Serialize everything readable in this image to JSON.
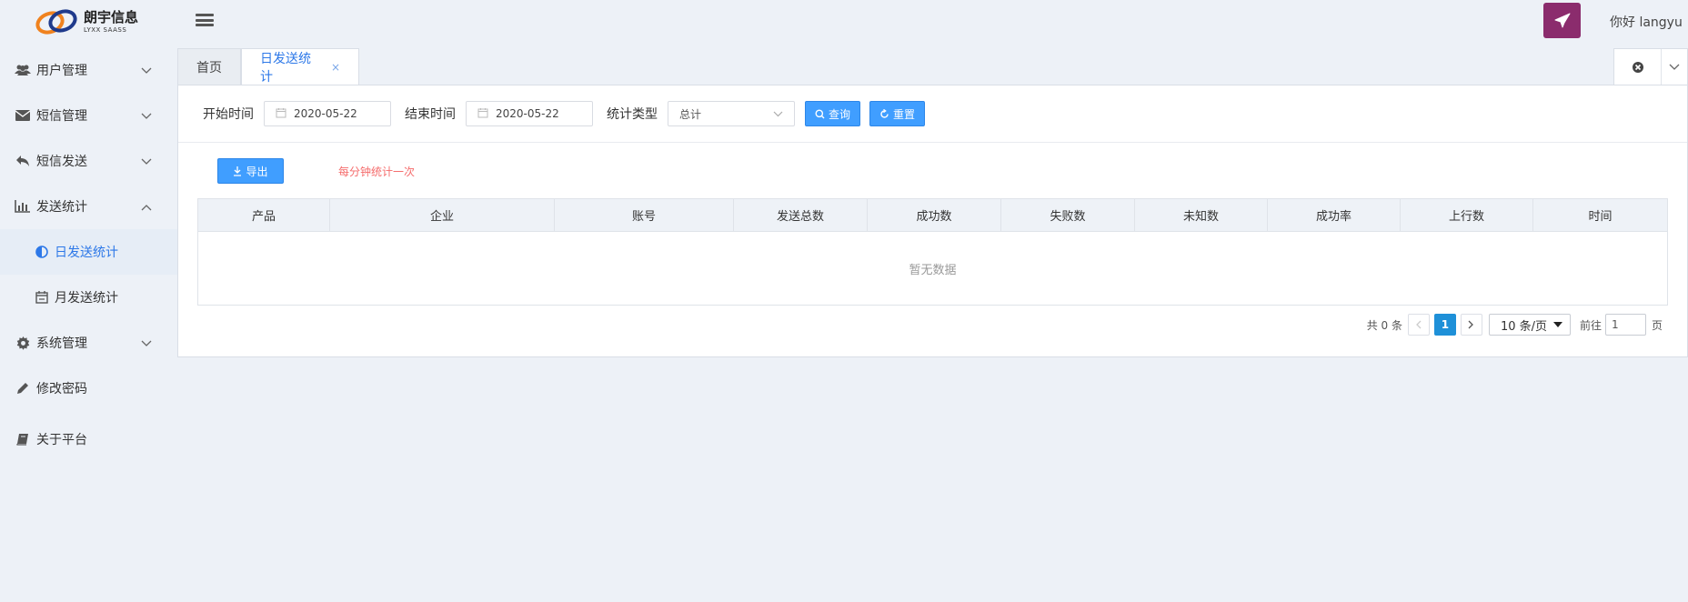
{
  "header": {
    "logo_title": "朗宇信息",
    "logo_sub": "LYXX SAASS",
    "greeting": "你好 langyu"
  },
  "sidebar": {
    "items": [
      {
        "label": "用户管理",
        "icon": "users-icon"
      },
      {
        "label": "短信管理",
        "icon": "envelope-icon"
      },
      {
        "label": "短信发送",
        "icon": "reply-icon"
      },
      {
        "label": "发送统计",
        "icon": "bar-chart-icon"
      },
      {
        "label": "日发送统计",
        "icon": "half-circle-icon"
      },
      {
        "label": "月发送统计",
        "icon": "calendar-icon"
      },
      {
        "label": "系统管理",
        "icon": "gear-icon"
      },
      {
        "label": "修改密码",
        "icon": "pencil-icon"
      },
      {
        "label": "关于平台",
        "icon": "book-icon"
      }
    ]
  },
  "tabs": {
    "home": "首页",
    "current": "日发送统计",
    "close": "×"
  },
  "filters": {
    "start_label": "开始时间",
    "start_value": "2020-05-22",
    "end_label": "结束时间",
    "end_value": "2020-05-22",
    "type_label": "统计类型",
    "type_value": "总计",
    "query_label": "查询",
    "reset_label": "重置"
  },
  "toolbar": {
    "export_label": "导出",
    "hint": "每分钟统计一次"
  },
  "table": {
    "columns": [
      "产品",
      "企业",
      "账号",
      "发送总数",
      "成功数",
      "失败数",
      "未知数",
      "成功率",
      "上行数",
      "时间"
    ],
    "empty_text": "暂无数据"
  },
  "pagination": {
    "total": "共 0 条",
    "current_page": "1",
    "page_size": "10 条/页",
    "goto_label": "前往",
    "goto_value": "1",
    "page_suffix": "页"
  },
  "colors": {
    "accent": "#409eff",
    "brand": "#8b2c6d",
    "hint": "#f56c6c"
  }
}
